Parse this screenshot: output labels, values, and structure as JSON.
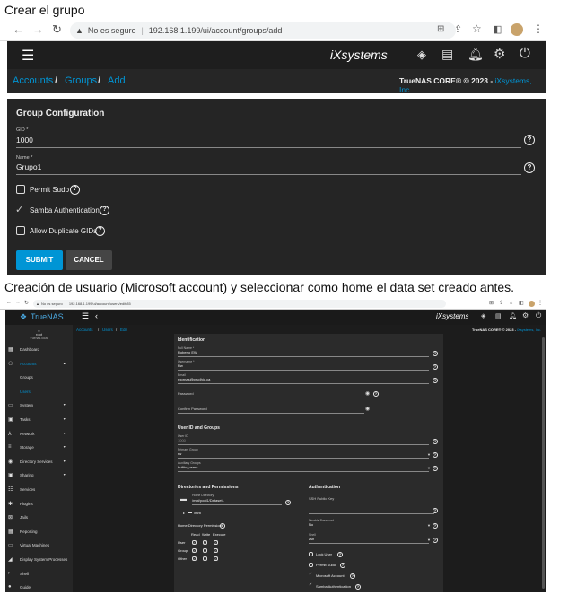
{
  "caption1": "Crear el grupo",
  "caption2": "Creación de usuario (Microsoft account) y seleccionar como home el data set creado antes.",
  "browser1": {
    "not_secure": "No es seguro",
    "url": "192.168.1.199/ui/account/groups/add"
  },
  "browser2": {
    "not_secure": "No es seguro",
    "url": "192.168.1.199/ui/account/users/edit/35"
  },
  "truenas": {
    "brand_logo": "iXsystems",
    "breadcrumb": {
      "accounts": "Accounts",
      "groups": "Groups",
      "add": "Add",
      "sep": "/"
    },
    "copyright_prefix": "TrueNAS CORE® © 2023 - ",
    "copyright_link": "iXsystems, Inc.",
    "accent": "#0095d5"
  },
  "group_form": {
    "title": "Group Configuration",
    "gid_label": "GID *",
    "gid_value": "1000",
    "name_label": "Name *",
    "name_value": "Grupo1",
    "permit_sudo": "Permit Sudo",
    "samba_auth": "Samba Authentication",
    "allow_dup": "Allow Duplicate GIDs",
    "submit": "SUBMIT",
    "cancel": "CANCEL"
  },
  "user_screen": {
    "logo": "TrueNAS",
    "user": {
      "name": "root",
      "host": "truenas.local"
    },
    "breadcrumb": {
      "accounts": "Accounts",
      "users": "Users",
      "edit": "Edit",
      "sep": "/"
    },
    "copyright": "TrueNAS CORE® © 2023 - ",
    "copyright_link": "iXsystems, Inc.",
    "sidebar": [
      {
        "label": "Dashboard",
        "arrow": ""
      },
      {
        "label": "Accounts",
        "arrow": "▲"
      },
      {
        "label": "Groups",
        "arrow": ""
      },
      {
        "label": "Users",
        "arrow": ""
      },
      {
        "label": "System",
        "arrow": "▼"
      },
      {
        "label": "Tasks",
        "arrow": "▼"
      },
      {
        "label": "Network",
        "arrow": "▼"
      },
      {
        "label": "Storage",
        "arrow": "▼"
      },
      {
        "label": "Directory Services",
        "arrow": "▼"
      },
      {
        "label": "Sharing",
        "arrow": "▼"
      },
      {
        "label": "Services",
        "arrow": ""
      },
      {
        "label": "Plugins",
        "arrow": ""
      },
      {
        "label": "Jails",
        "arrow": ""
      },
      {
        "label": "Reporting",
        "arrow": ""
      },
      {
        "label": "Virtual Machines",
        "arrow": ""
      },
      {
        "label": "Display System Processes",
        "arrow": ""
      },
      {
        "label": "Shell",
        "arrow": ""
      },
      {
        "label": "Guide",
        "arrow": ""
      }
    ],
    "identification": {
      "title": "Identification",
      "fullname_label": "Full Name *",
      "fullname_value": "Roberto EW",
      "username_label": "Username *",
      "username_value": "Rw",
      "email_label": "Email",
      "email_value": "rbornas@prudhio.ca",
      "password_label": "Password",
      "confirm_label": "Confirm Password"
    },
    "userid": {
      "title": "User ID and Groups",
      "uid_label": "User ID",
      "uid_value": "1000",
      "primary_label": "Primary Group",
      "primary_value": "rw",
      "aux_label": "Auxiliary Groups",
      "aux_value": "builtin_users"
    },
    "dirs": {
      "title": "Directories and Permissions",
      "home_label": "Home Directory",
      "home_value": "/mnt/pool1/Dataset1",
      "tree_item": "/mnt",
      "perm_label": "Home Directory Permissions",
      "cols": [
        "Read",
        "Write",
        "Execute"
      ],
      "rows": [
        "User",
        "Group",
        "Other"
      ]
    },
    "auth": {
      "title": "Authentication",
      "ssh_label": "SSH Public Key",
      "disable_pw_label": "Disable Password",
      "disable_pw_value": "No",
      "shell_label": "Shell",
      "shell_value": "zsh",
      "lock": "Lock User",
      "sudo": "Permit Sudo",
      "ms": "Microsoft Account",
      "samba": "Samba Authentication"
    }
  }
}
